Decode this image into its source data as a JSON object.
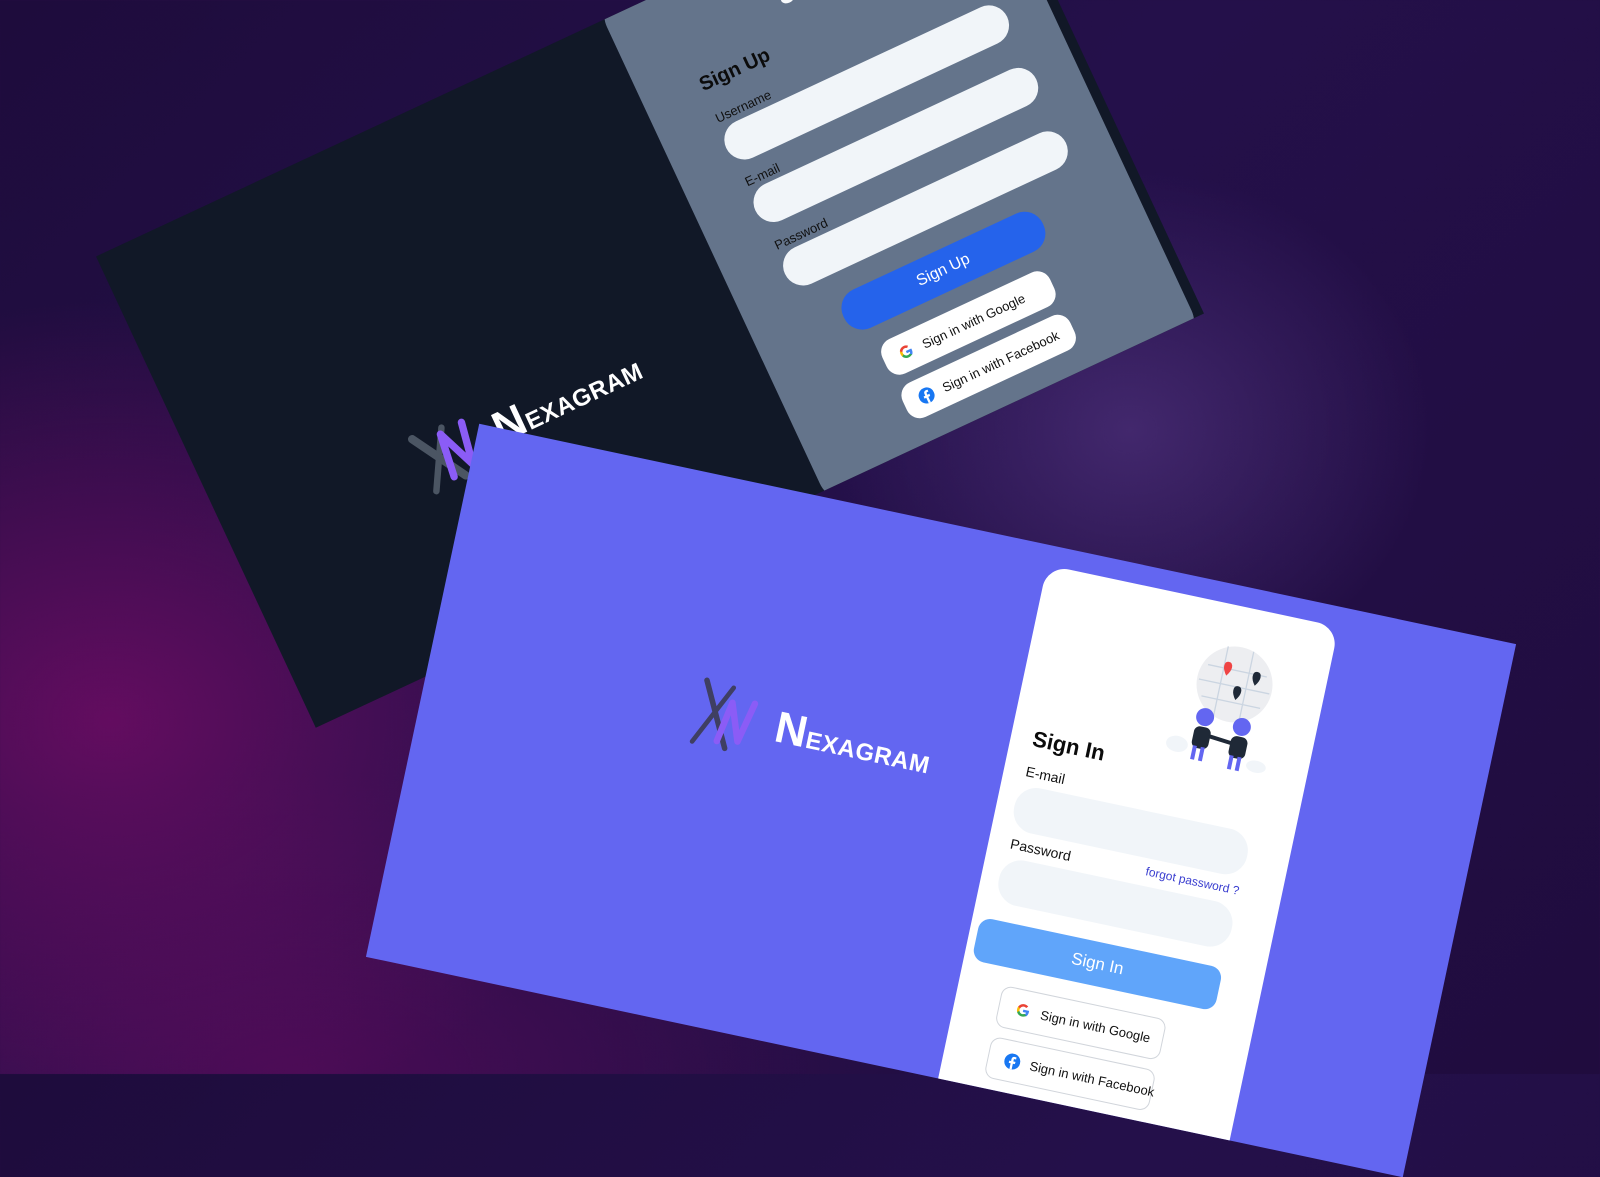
{
  "brand": {
    "name_initial": "N",
    "name_rest": "EXAGRAM"
  },
  "signup": {
    "title": "Sign Up",
    "username_label": "Username",
    "email_label": "E-mail",
    "password_label": "Password",
    "submit": "Sign Up",
    "google": "Sign in with Google",
    "facebook": "Sign in with Facebook"
  },
  "signin": {
    "title": "Sign In",
    "email_label": "E-mail",
    "password_label": "Password",
    "forgot": "forgot password ?",
    "submit": "Sign In",
    "google": "Sign in with Google",
    "facebook": "Sign in with Facebook"
  },
  "colors": {
    "dark_screen": "#111827",
    "signup_card": "#64748b",
    "signup_button": "#2563eb",
    "light_screen": "#6366f1",
    "signin_card": "#ffffff",
    "signin_button": "#60a5fa",
    "input": "#f1f5f9",
    "accent_purple": "#8b5cf6"
  },
  "icons": [
    "logo-mark",
    "google-icon",
    "facebook-icon",
    "world-illustration"
  ]
}
